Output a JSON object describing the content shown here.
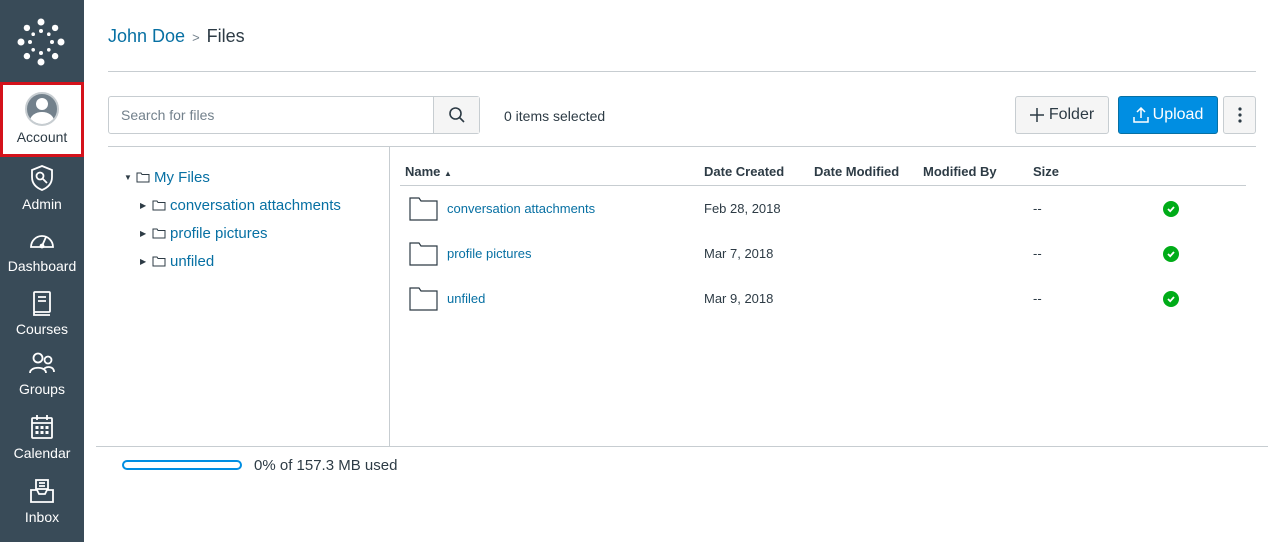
{
  "nav": {
    "items": [
      {
        "label": "Account",
        "icon": "user-avatar-icon"
      },
      {
        "label": "Admin",
        "icon": "admin-shield-icon"
      },
      {
        "label": "Dashboard",
        "icon": "speedometer-icon"
      },
      {
        "label": "Courses",
        "icon": "book-icon"
      },
      {
        "label": "Groups",
        "icon": "users-icon"
      },
      {
        "label": "Calendar",
        "icon": "calendar-icon"
      },
      {
        "label": "Inbox",
        "icon": "inbox-icon"
      }
    ]
  },
  "breadcrumb": {
    "user": "John Doe",
    "separator": ">",
    "current": "Files"
  },
  "toolbar": {
    "search_placeholder": "Search for files",
    "selected_count": "0 items selected",
    "folder_label": "Folder",
    "upload_label": "Upload"
  },
  "tree": {
    "root": "My Files",
    "children": [
      "conversation attachments",
      "profile pictures",
      "unfiled"
    ]
  },
  "table": {
    "headers": {
      "name": "Name",
      "date_created": "Date Created",
      "date_modified": "Date Modified",
      "modified_by": "Modified By",
      "size": "Size"
    },
    "sort_indicator": "▲",
    "rows": [
      {
        "name": "conversation attachments",
        "date_created": "Feb 28, 2018",
        "date_modified": "",
        "modified_by": "",
        "size": "--",
        "status": "published"
      },
      {
        "name": "profile pictures",
        "date_created": "Mar 7, 2018",
        "date_modified": "",
        "modified_by": "",
        "size": "--",
        "status": "published"
      },
      {
        "name": "unfiled",
        "date_created": "Mar 9, 2018",
        "date_modified": "",
        "modified_by": "",
        "size": "--",
        "status": "published"
      }
    ]
  },
  "quota": {
    "used_percent": 0,
    "text": "0% of 157.3 MB used"
  },
  "colors": {
    "nav_bg": "#394b58",
    "link": "#0770a3",
    "primary": "#008ee2",
    "success": "#00ac18",
    "highlight": "#d4121b"
  }
}
